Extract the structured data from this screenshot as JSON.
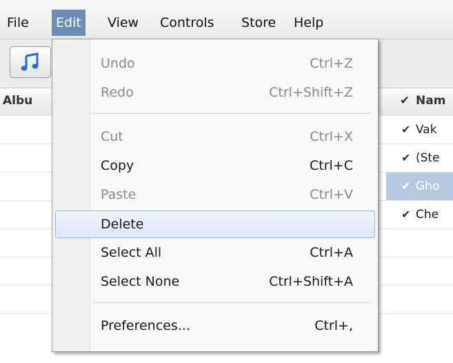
{
  "menubar": {
    "items": [
      "File",
      "Edit",
      "View",
      "Controls",
      "Store",
      "Help"
    ],
    "open_menu": "Edit"
  },
  "icons": {
    "toolbar_button": "music-note-icon",
    "checkmark": "checkmark-icon"
  },
  "colors": {
    "menu_open": "#6b8eb8",
    "row_selected": "#b7c9e0",
    "menu_highlight_border": "#9cb8d9"
  },
  "table": {
    "headers": {
      "album": "Albu",
      "check": "✔",
      "name": "Nam"
    },
    "rows": [
      {
        "checked": "✔",
        "name": "Vak"
      },
      {
        "checked": "✔",
        "name": "(Ste"
      },
      {
        "checked": "✔",
        "name": "Gho",
        "selected": true
      },
      {
        "checked": "✔",
        "name": "Che"
      }
    ]
  },
  "edit_menu": {
    "items": [
      {
        "label": "Undo",
        "shortcut": "Ctrl+Z",
        "enabled": false
      },
      {
        "label": "Redo",
        "shortcut": "Ctrl+Shift+Z",
        "enabled": false
      },
      {
        "label": "Cut",
        "shortcut": "Ctrl+X",
        "enabled": false
      },
      {
        "label": "Copy",
        "shortcut": "Ctrl+C",
        "enabled": true
      },
      {
        "label": "Paste",
        "shortcut": "Ctrl+V",
        "enabled": false
      },
      {
        "label": "Delete",
        "shortcut": "",
        "enabled": true,
        "highlighted": true
      },
      {
        "label": "Select All",
        "shortcut": "Ctrl+A",
        "enabled": true
      },
      {
        "label": "Select None",
        "shortcut": "Ctrl+Shift+A",
        "enabled": true
      },
      {
        "label": "Preferences...",
        "shortcut": "Ctrl+,",
        "enabled": true
      }
    ]
  }
}
